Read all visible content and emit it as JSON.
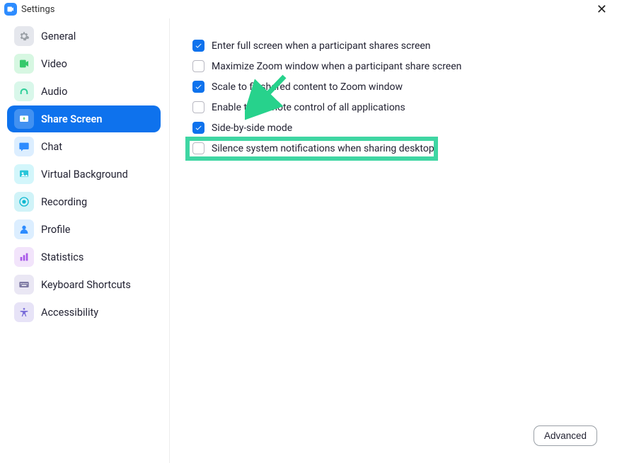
{
  "window": {
    "title": "Settings"
  },
  "sidebar": {
    "items": [
      {
        "label": "General",
        "icon": "gear",
        "bg": "#e5e7ed",
        "fg": "#9aa0a6",
        "active": false
      },
      {
        "label": "Video",
        "icon": "video",
        "bg": "#d7f7e2",
        "fg": "#35c96b",
        "active": false
      },
      {
        "label": "Audio",
        "icon": "audio",
        "bg": "#d9f7ea",
        "fg": "#2fcf9a",
        "active": false
      },
      {
        "label": "Share Screen",
        "icon": "share",
        "bg": "#50c96b",
        "fg": "#ffffff",
        "active": true
      },
      {
        "label": "Chat",
        "icon": "chat",
        "bg": "#dceeff",
        "fg": "#2D8CFF",
        "active": false
      },
      {
        "label": "Virtual Background",
        "icon": "bg",
        "bg": "#d3f6fb",
        "fg": "#29c6d9",
        "active": false
      },
      {
        "label": "Recording",
        "icon": "record",
        "bg": "#d0f3f8",
        "fg": "#0fb8d0",
        "active": false
      },
      {
        "label": "Profile",
        "icon": "profile",
        "bg": "#dceeff",
        "fg": "#2D8CFF",
        "active": false
      },
      {
        "label": "Statistics",
        "icon": "stats",
        "bg": "#f2e4fb",
        "fg": "#a858e8",
        "active": false
      },
      {
        "label": "Keyboard Shortcuts",
        "icon": "keyboard",
        "bg": "#eae7f4",
        "fg": "#7d78a3",
        "active": false
      },
      {
        "label": "Accessibility",
        "icon": "access",
        "bg": "#e7e3f7",
        "fg": "#7a6ed9",
        "active": false
      }
    ]
  },
  "options": [
    {
      "label": "Enter full screen when a participant shares screen",
      "checked": true,
      "highlight": false
    },
    {
      "label": "Maximize Zoom window when a participant share screen",
      "checked": false,
      "highlight": false
    },
    {
      "label": "Scale to fit shared content to Zoom window",
      "checked": true,
      "highlight": false
    },
    {
      "label": "Enable the remote control of all applications",
      "checked": false,
      "highlight": false
    },
    {
      "label": "Side-by-side mode",
      "checked": true,
      "highlight": false
    },
    {
      "label": "Silence system notifications when sharing desktop",
      "checked": false,
      "highlight": true
    }
  ],
  "buttons": {
    "advanced": "Advanced"
  }
}
